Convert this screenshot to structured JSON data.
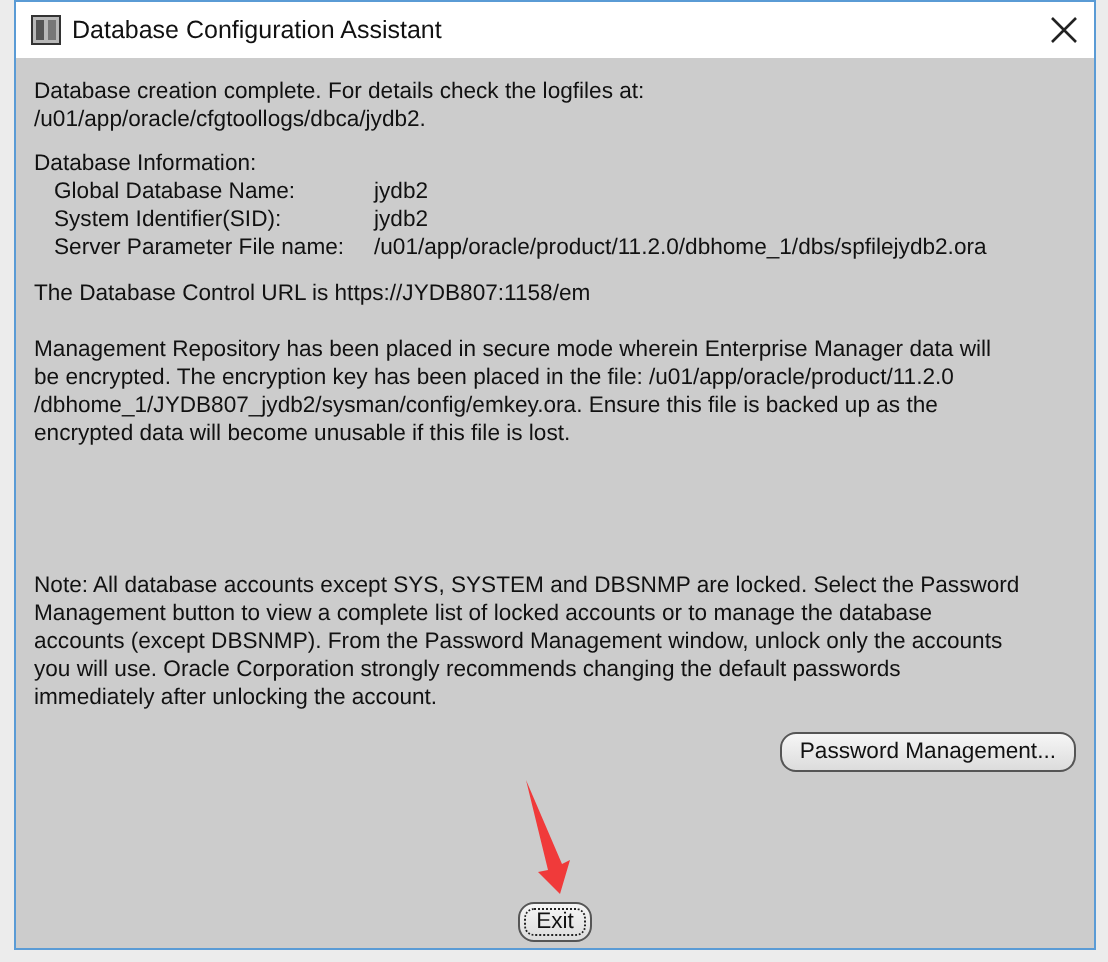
{
  "window": {
    "title": "Database Configuration Assistant"
  },
  "log_message": "Database creation complete. For details check the logfiles at:",
  "log_path": " /u01/app/oracle/cfgtoollogs/dbca/jydb2.",
  "database_information": {
    "heading": "Database Information:",
    "rows": [
      {
        "label": "Global Database Name:",
        "value": "jydb2"
      },
      {
        "label": "System Identifier(SID):",
        "value": "jydb2"
      },
      {
        "label": "Server Parameter File name:",
        "value": "/u01/app/oracle/product/11.2.0/dbhome_1/dbs/spfilejydb2.ora"
      }
    ]
  },
  "control_url": "The Database Control URL is https://JYDB807:1158/em",
  "repository_message": "Management Repository has been placed in secure mode wherein Enterprise Manager data will\nbe encrypted.  The encryption key has been placed in the file: /u01/app/oracle/product/11.2.0\n/dbhome_1/JYDB807_jydb2/sysman/config/emkey.ora. Ensure this file is backed up as the\nencrypted data will become unusable if this file is lost.",
  "note": "Note: All database accounts except SYS, SYSTEM and DBSNMP are locked. Select the Password\nManagement button to view a complete list of locked accounts or to manage the database\naccounts (except DBSNMP). From the Password Management window, unlock only the accounts\nyou will use. Oracle Corporation strongly recommends changing the default passwords\nimmediately after unlocking the account.",
  "password_button": {
    "label": "Password Management...",
    "focused": false
  },
  "exit_button": {
    "label": "Exit",
    "focused": true
  }
}
